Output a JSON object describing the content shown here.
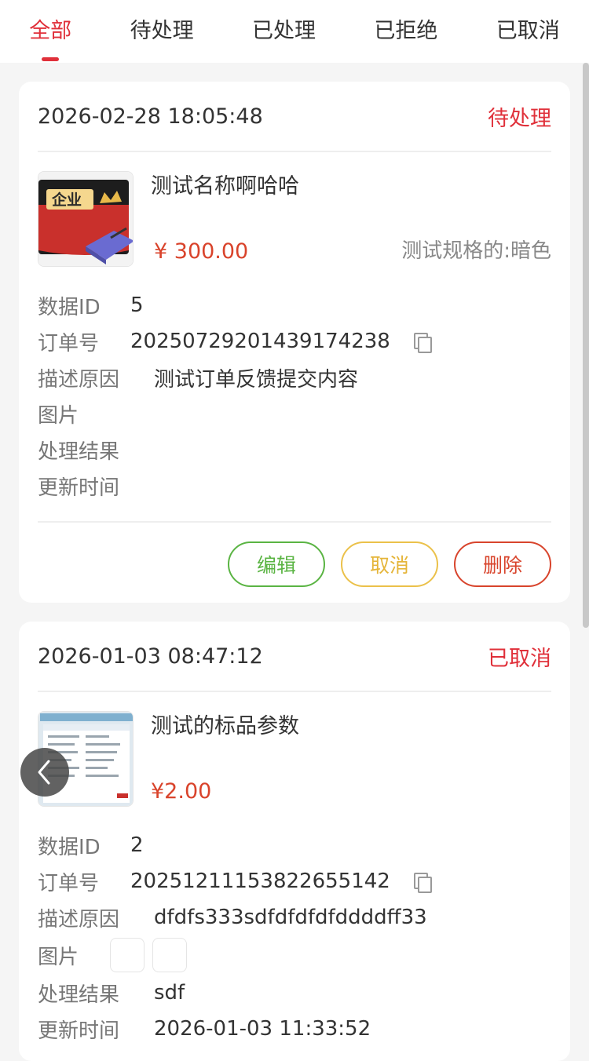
{
  "tabs": [
    {
      "label": "全部",
      "active": true
    },
    {
      "label": "待处理",
      "active": false
    },
    {
      "label": "已处理",
      "active": false
    },
    {
      "label": "已拒绝",
      "active": false
    },
    {
      "label": "已取消",
      "active": false
    }
  ],
  "colors": {
    "accent": "#e0303a",
    "price": "#d9432b",
    "edit": "#5ab443",
    "cancel": "#ebc14a",
    "delete": "#d8442c"
  },
  "orders": [
    {
      "time": "2026-02-28 18:05:48",
      "status": "待处理",
      "product_name": "测试名称啊哈哈",
      "price": "¥ 300.00",
      "spec": "测试规格的:暗色",
      "thumb_text": "企业",
      "fields": {
        "data_id_label": "数据ID",
        "data_id": "5",
        "order_no_label": "订单号",
        "order_no": "20250729201439174238",
        "reason_label": "描述原因",
        "reason": "测试订单反馈提交内容",
        "images_label": "图片",
        "result_label": "处理结果",
        "result": "",
        "updated_label": "更新时间",
        "updated": ""
      },
      "actions": {
        "edit": "编辑",
        "cancel": "取消",
        "delete": "删除"
      }
    },
    {
      "time": "2026-01-03 08:47:12",
      "status": "已取消",
      "product_name": "测试的标品参数",
      "price": "¥2.00",
      "spec": "",
      "fields": {
        "data_id_label": "数据ID",
        "data_id": "2",
        "order_no_label": "订单号",
        "order_no": "20251211153822655142",
        "reason_label": "描述原因",
        "reason": "dfdfs333sdfdfdfdfddddff33",
        "images_label": "图片",
        "result_label": "处理结果",
        "result": "sdf",
        "updated_label": "更新时间",
        "updated": "2026-01-03 11:33:52"
      }
    }
  ]
}
